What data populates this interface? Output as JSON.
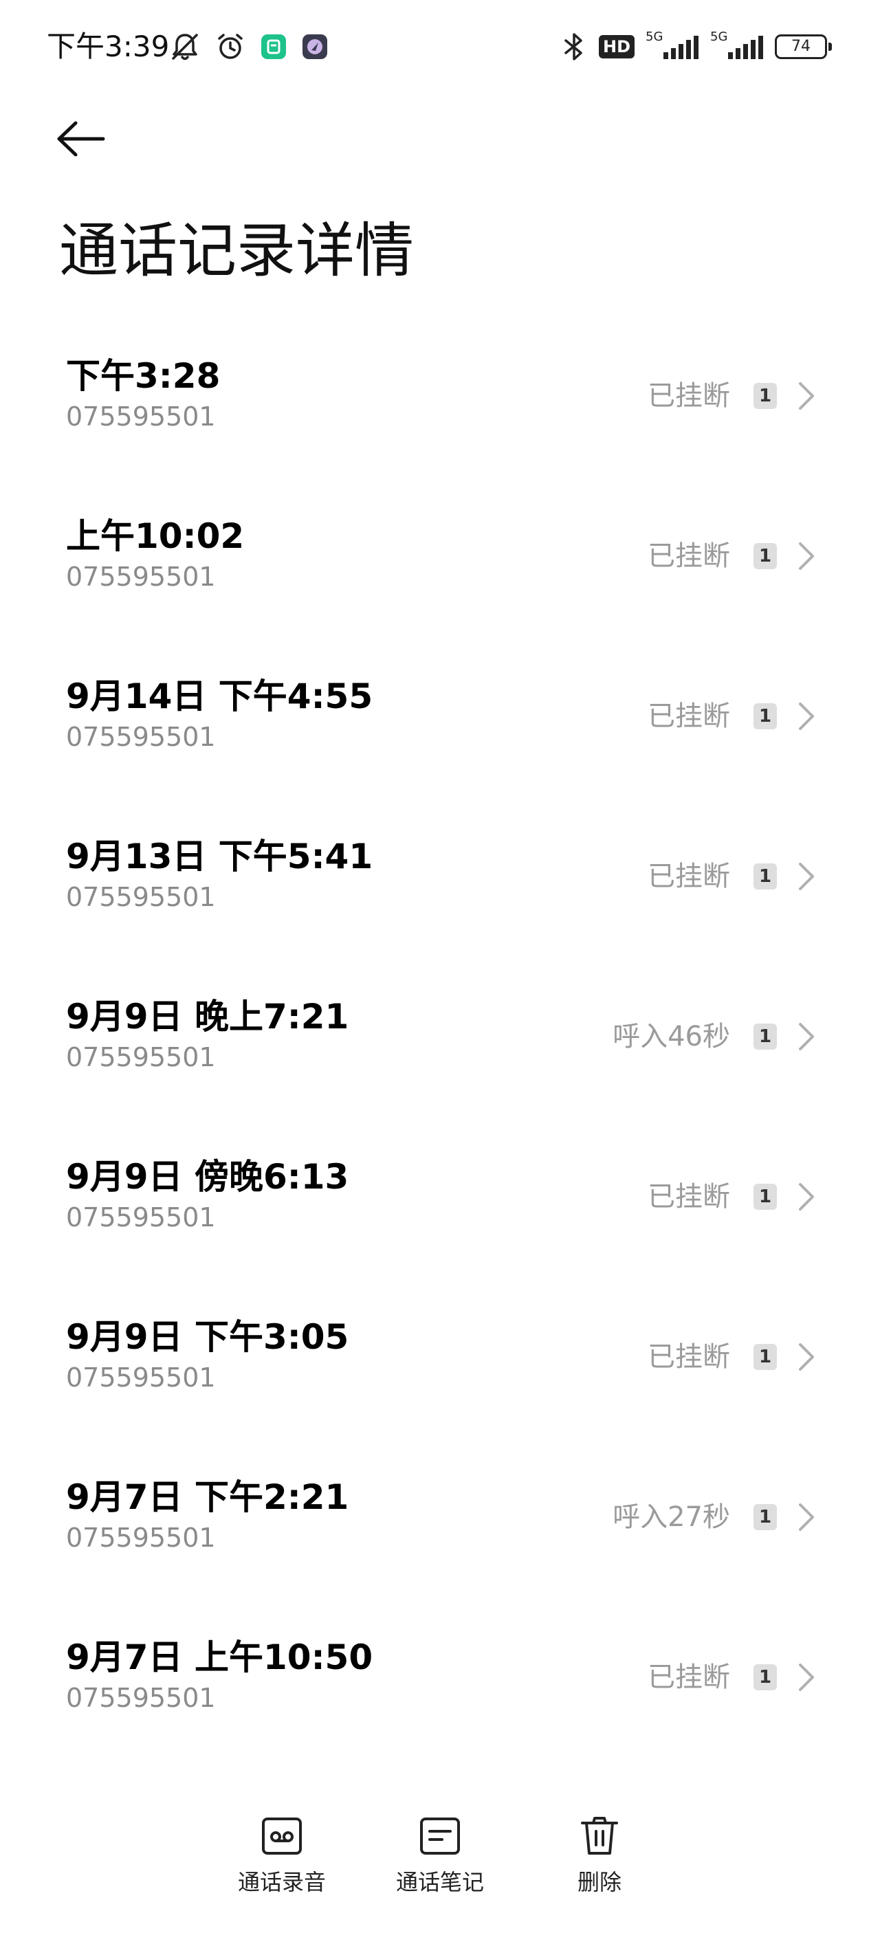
{
  "status_bar": {
    "time": "下午3:39",
    "battery": "74",
    "network_badge": "HD",
    "signal_1_label": "5G",
    "signal_2_label": "5G",
    "left_icons": [
      "mute-icon",
      "alarm-icon",
      "app-icon-green",
      "app-icon-purple"
    ],
    "right_icons": [
      "bluetooth-icon",
      "hd-icon",
      "signal-icon",
      "signal-icon",
      "battery-icon"
    ]
  },
  "header": {
    "title": "通话记录详情"
  },
  "calls": [
    {
      "time": "下午3:28",
      "number": "075595501",
      "status": "已挂断",
      "sim": "1"
    },
    {
      "time": "上午10:02",
      "number": "075595501",
      "status": "已挂断",
      "sim": "1"
    },
    {
      "time": "9月14日 下午4:55",
      "number": "075595501",
      "status": "已挂断",
      "sim": "1"
    },
    {
      "time": "9月13日 下午5:41",
      "number": "075595501",
      "status": "已挂断",
      "sim": "1"
    },
    {
      "time": "9月9日 晚上7:21",
      "number": "075595501",
      "status": "呼入46秒",
      "sim": "1"
    },
    {
      "time": "9月9日 傍晚6:13",
      "number": "075595501",
      "status": "已挂断",
      "sim": "1"
    },
    {
      "time": "9月9日 下午3:05",
      "number": "075595501",
      "status": "已挂断",
      "sim": "1"
    },
    {
      "time": "9月7日 下午2:21",
      "number": "075595501",
      "status": "呼入27秒",
      "sim": "1"
    },
    {
      "time": "9月7日 上午10:50",
      "number": "075595501",
      "status": "已挂断",
      "sim": "1"
    }
  ],
  "actions": {
    "recording_label": "通话录音",
    "notes_label": "通话笔记",
    "delete_label": "删除"
  },
  "colors": {
    "primary_text": "#000000",
    "secondary_text": "#8a8a8a",
    "status_text": "#9a9a9a",
    "sim_badge_bg": "#dedede",
    "background": "#ffffff"
  }
}
